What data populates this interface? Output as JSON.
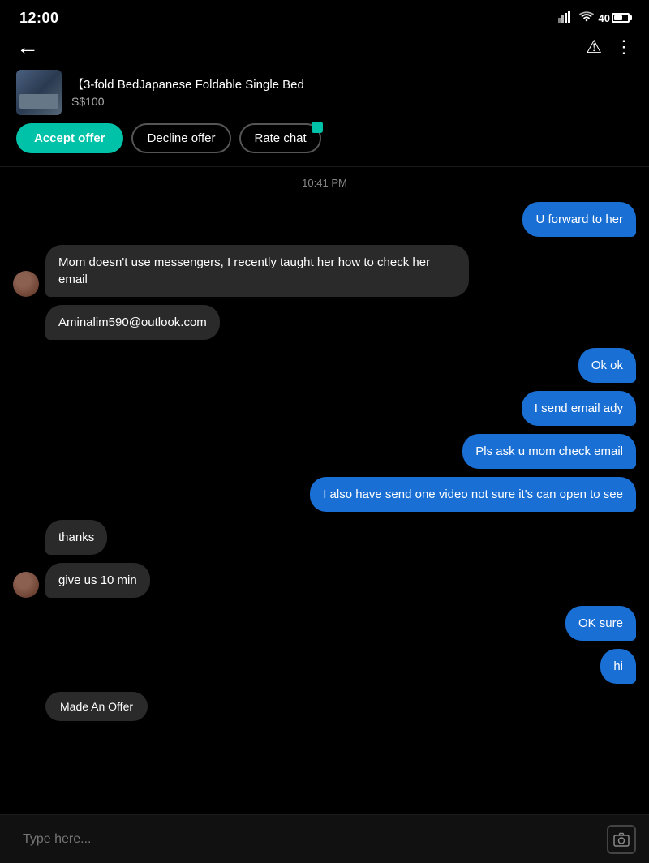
{
  "statusBar": {
    "time": "12:00",
    "battery": "40"
  },
  "nav": {
    "backLabel": "←",
    "alertIcon": "⚠",
    "moreIcon": "⋮"
  },
  "product": {
    "title": "【3-fold BedJapanese Foldable Single Bed",
    "price": "S$100"
  },
  "buttons": {
    "accept": "Accept offer",
    "decline": "Decline offer",
    "rate": "Rate chat"
  },
  "chat": {
    "timestamp": "10:41 PM",
    "messages": [
      {
        "id": 1,
        "type": "sent",
        "text": "U forward to her"
      },
      {
        "id": 2,
        "type": "received",
        "text": "Mom doesn't use messengers, I recently taught her how to check her email",
        "avatar": true
      },
      {
        "id": 3,
        "type": "received",
        "text": "Aminalim590@outlook.com",
        "avatar": false
      },
      {
        "id": 4,
        "type": "sent",
        "text": "Ok ok"
      },
      {
        "id": 5,
        "type": "sent",
        "text": "I send email ady"
      },
      {
        "id": 6,
        "type": "sent",
        "text": "Pls ask u mom check email"
      },
      {
        "id": 7,
        "type": "sent",
        "text": "I also have send one video not sure it's can open to see"
      },
      {
        "id": 8,
        "type": "received",
        "text": "thanks",
        "avatar": false
      },
      {
        "id": 9,
        "type": "received",
        "text": "give us 10 min",
        "avatar": true
      },
      {
        "id": 10,
        "type": "sent",
        "text": "OK sure"
      },
      {
        "id": 11,
        "type": "sent",
        "text": "hi"
      },
      {
        "id": 12,
        "type": "received-offer",
        "text": "Made An Offer",
        "avatar": false
      }
    ]
  },
  "inputBar": {
    "placeholder": "Type here..."
  }
}
